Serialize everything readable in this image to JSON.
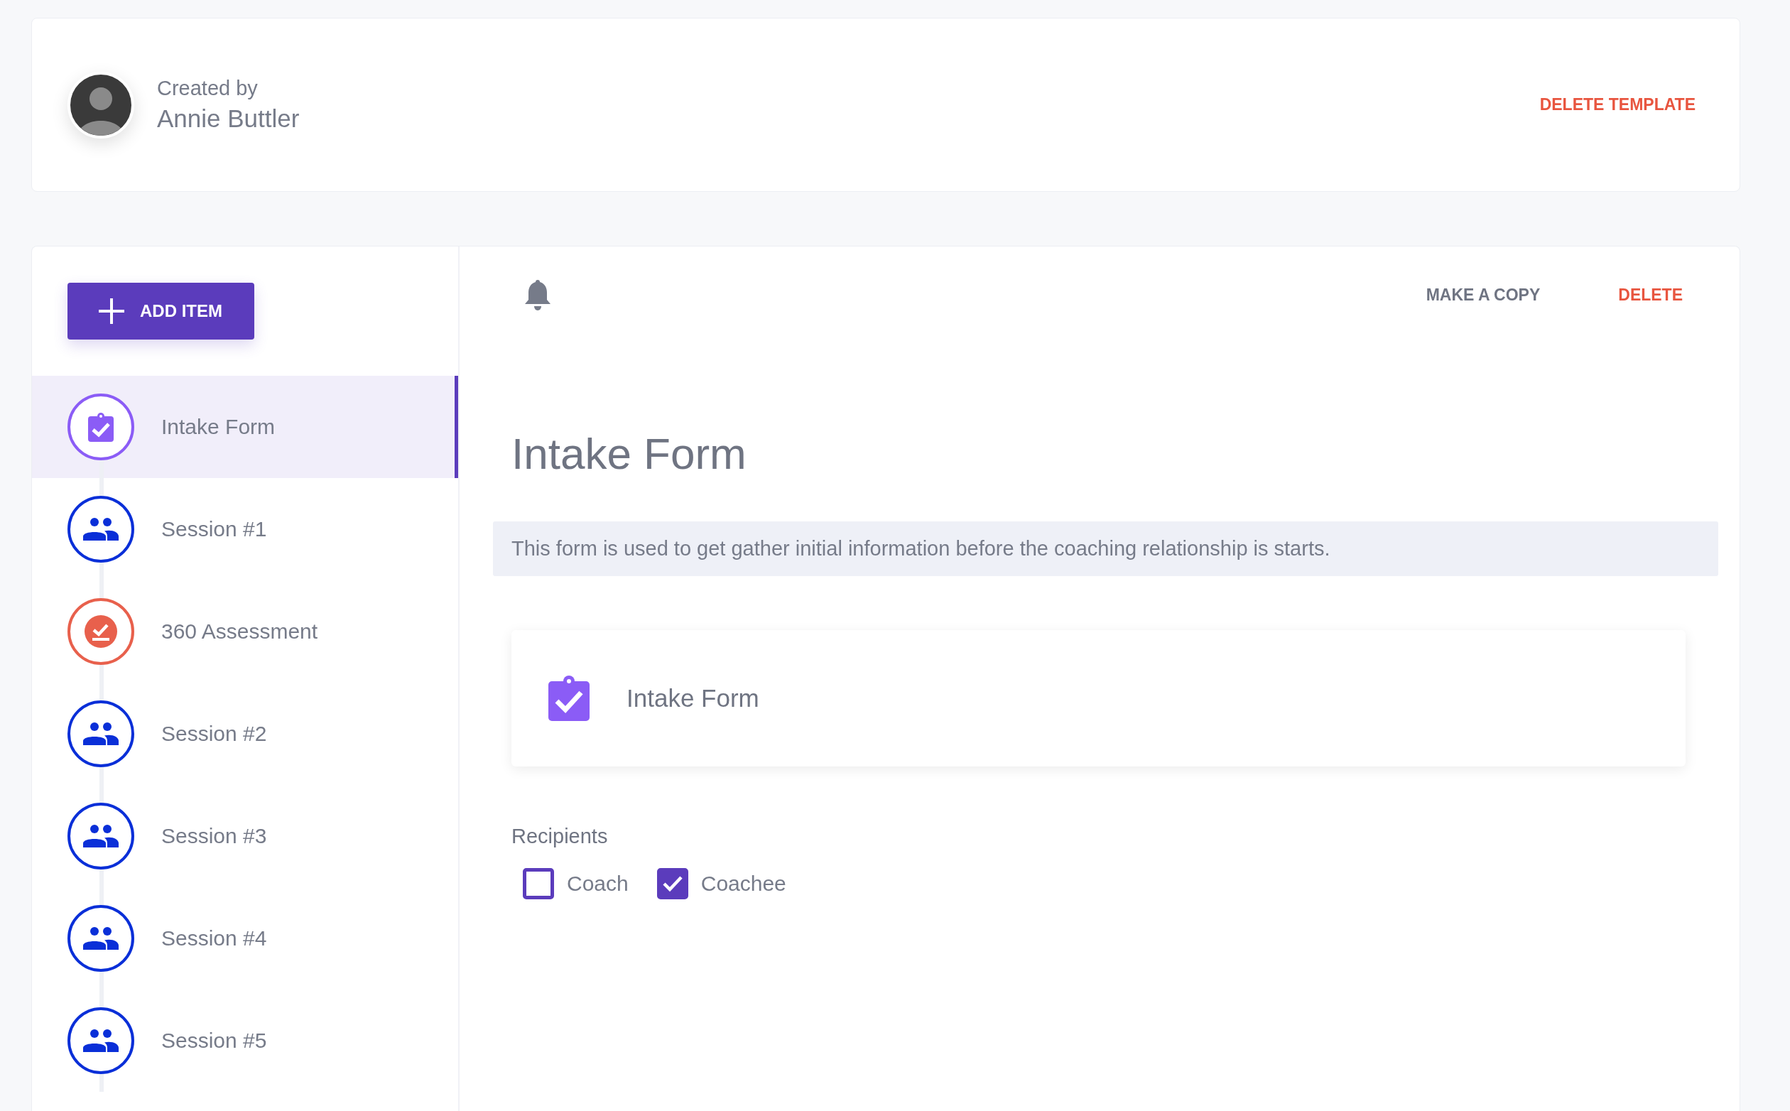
{
  "header": {
    "created_by_label": "Created by",
    "author": "Annie Buttler",
    "delete_template": "DELETE TEMPLATE"
  },
  "sidebar": {
    "add_button": "ADD ITEM",
    "items": [
      {
        "label": "Intake Form",
        "kind": "form",
        "selected": true
      },
      {
        "label": "Session #1",
        "kind": "session",
        "selected": false
      },
      {
        "label": "360 Assessment",
        "kind": "assessment",
        "selected": false
      },
      {
        "label": "Session #2",
        "kind": "session",
        "selected": false
      },
      {
        "label": "Session #3",
        "kind": "session",
        "selected": false
      },
      {
        "label": "Session #4",
        "kind": "session",
        "selected": false
      },
      {
        "label": "Session #5",
        "kind": "session",
        "selected": false
      }
    ]
  },
  "main": {
    "make_copy": "MAKE A COPY",
    "delete": "DELETE",
    "title": "Intake Form",
    "description": "This form is used to get gather initial information before the coaching relationship is starts.",
    "form_card": {
      "title": "Intake Form"
    },
    "recipients": {
      "label": "Recipients",
      "options": [
        {
          "label": "Coach",
          "checked": false
        },
        {
          "label": "Coachee",
          "checked": true
        }
      ]
    }
  }
}
